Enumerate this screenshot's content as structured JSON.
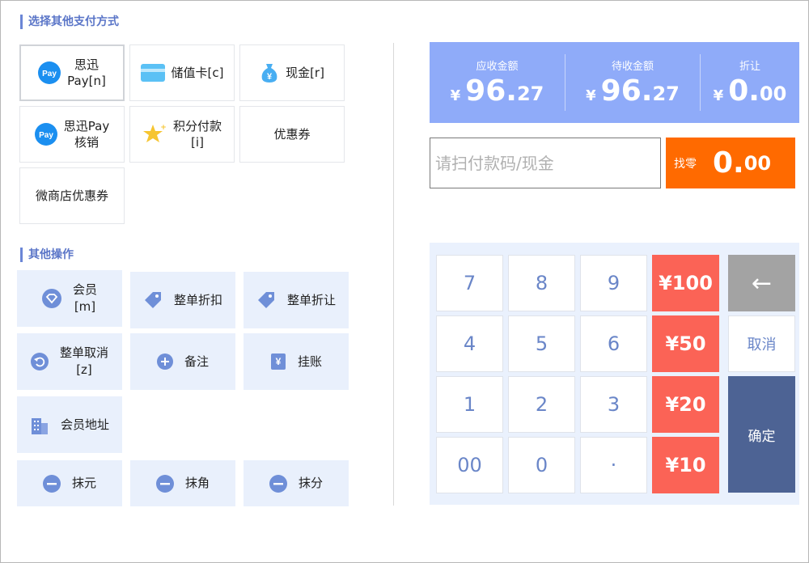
{
  "sections": {
    "payment_title": "选择其他支付方式",
    "ops_title": "其他操作"
  },
  "payment_methods": [
    {
      "label": "思迅\nPay[n]",
      "icon": "pay-icon"
    },
    {
      "label": "储值卡[c]",
      "icon": "card-icon"
    },
    {
      "label": "现金[r]",
      "icon": "money-bag-icon"
    },
    {
      "label": "思迅Pay\n核销",
      "icon": "pay-icon"
    },
    {
      "label": "积分付款\n[i]",
      "icon": "star-icon"
    },
    {
      "label": "优惠券",
      "icon": ""
    },
    {
      "label": "微商店优惠券",
      "icon": ""
    }
  ],
  "operations": [
    {
      "label": "会员\n[m]",
      "icon": "diamond-icon"
    },
    {
      "label": "整单折扣",
      "icon": "tag-icon"
    },
    {
      "label": "整单折让",
      "icon": "tag-icon"
    },
    {
      "label": "整单取消\n[z]",
      "icon": "undo-icon"
    },
    {
      "label": "备注",
      "icon": "plus-circle-icon"
    },
    {
      "label": "挂账",
      "icon": "yen-doc-icon"
    },
    {
      "label": "会员地址",
      "icon": "building-icon"
    },
    {
      "label": "抹元",
      "icon": "minus-circle-icon"
    },
    {
      "label": "抹角",
      "icon": "minus-circle-icon"
    },
    {
      "label": "抹分",
      "icon": "minus-circle-icon"
    }
  ],
  "summary": {
    "receivable": {
      "caption": "应收金额",
      "currency": "¥",
      "int": "96.",
      "dec": "27"
    },
    "pending": {
      "caption": "待收金额",
      "currency": "¥",
      "int": "96.",
      "dec": "27"
    },
    "discount": {
      "caption": "折让",
      "currency": "¥",
      "int": "0.",
      "dec": "00"
    }
  },
  "input": {
    "placeholder": "请扫付款码/现金"
  },
  "change": {
    "caption": "找零",
    "int": "0.",
    "dec": "00"
  },
  "keypad": {
    "k7": "7",
    "k8": "8",
    "k9": "9",
    "k4": "4",
    "k5": "5",
    "k6": "6",
    "k1": "1",
    "k2": "2",
    "k3": "3",
    "k00": "00",
    "k0": "0",
    "kdot": "·",
    "m100": "¥100",
    "m50": "¥50",
    "m20": "¥20",
    "m10": "¥10",
    "back": "←",
    "cancel": "取消",
    "confirm": "确定"
  },
  "colors": {
    "accent": "#6b86d6",
    "summary_bg": "#8fabf9",
    "change_bg": "#ff6a00",
    "money_key": "#fb6356",
    "confirm_key": "#4d6394"
  }
}
